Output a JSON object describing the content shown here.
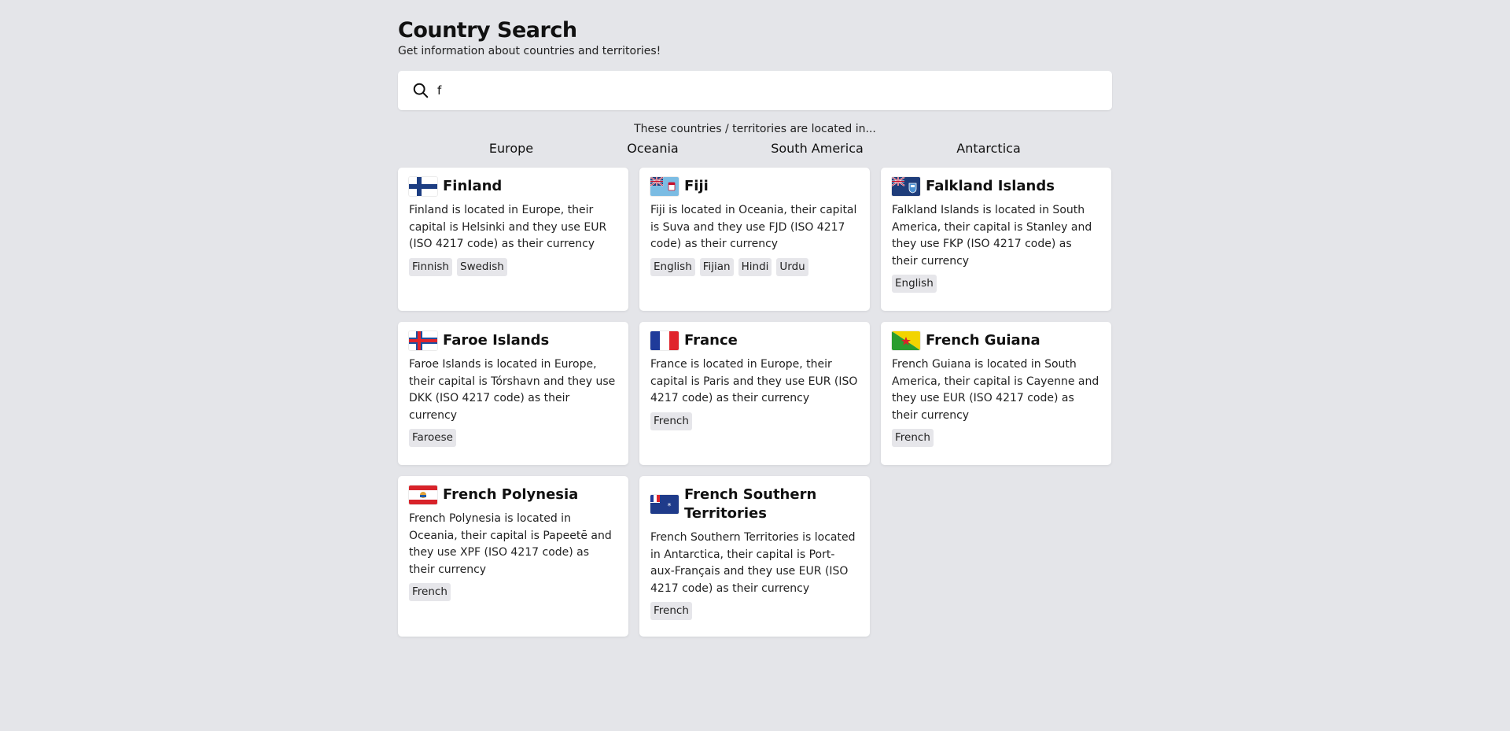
{
  "header": {
    "title": "Country Search",
    "subtitle": "Get information about countries and territories!"
  },
  "search": {
    "value": "f",
    "icon": "search-icon"
  },
  "located_text": "These countries / territories are located in...",
  "regions": [
    "Europe",
    "Oceania",
    "South America",
    "Antarctica"
  ],
  "cards": [
    {
      "name": "Finland",
      "flag": "finland-flag",
      "description": "Finland is located in Europe, their capital is Helsinki and they use EUR (ISO 4217 code) as their currency",
      "languages": [
        "Finnish",
        "Swedish"
      ]
    },
    {
      "name": "Fiji",
      "flag": "fiji-flag",
      "description": "Fiji is located in Oceania, their capital is Suva and they use FJD (ISO 4217 code) as their currency",
      "languages": [
        "English",
        "Fijian",
        "Hindi",
        "Urdu"
      ]
    },
    {
      "name": "Falkland Islands",
      "flag": "falkland-islands-flag",
      "description": "Falkland Islands is located in South America, their capital is Stanley and they use FKP (ISO 4217 code) as their currency",
      "languages": [
        "English"
      ]
    },
    {
      "name": "Faroe Islands",
      "flag": "faroe-islands-flag",
      "description": "Faroe Islands is located in Europe, their capital is Tórshavn and they use DKK (ISO 4217 code) as their currency",
      "languages": [
        "Faroese"
      ]
    },
    {
      "name": "France",
      "flag": "france-flag",
      "description": "France is located in Europe, their capital is Paris and they use EUR (ISO 4217 code) as their currency",
      "languages": [
        "French"
      ]
    },
    {
      "name": "French Guiana",
      "flag": "french-guiana-flag",
      "description": "French Guiana is located in South America, their capital is Cayenne and they use EUR (ISO 4217 code) as their currency",
      "languages": [
        "French"
      ]
    },
    {
      "name": "French Polynesia",
      "flag": "french-polynesia-flag",
      "description": "French Polynesia is located in Oceania, their capital is Papeetē and they use XPF (ISO 4217 code) as their currency",
      "languages": [
        "French"
      ]
    },
    {
      "name": "French Southern Territories",
      "flag": "french-southern-territories-flag",
      "description": "French Southern Territories is located in Antarctica, their capital is Port-aux-Français and they use EUR (ISO 4217 code) as their currency",
      "languages": [
        "French"
      ]
    }
  ]
}
